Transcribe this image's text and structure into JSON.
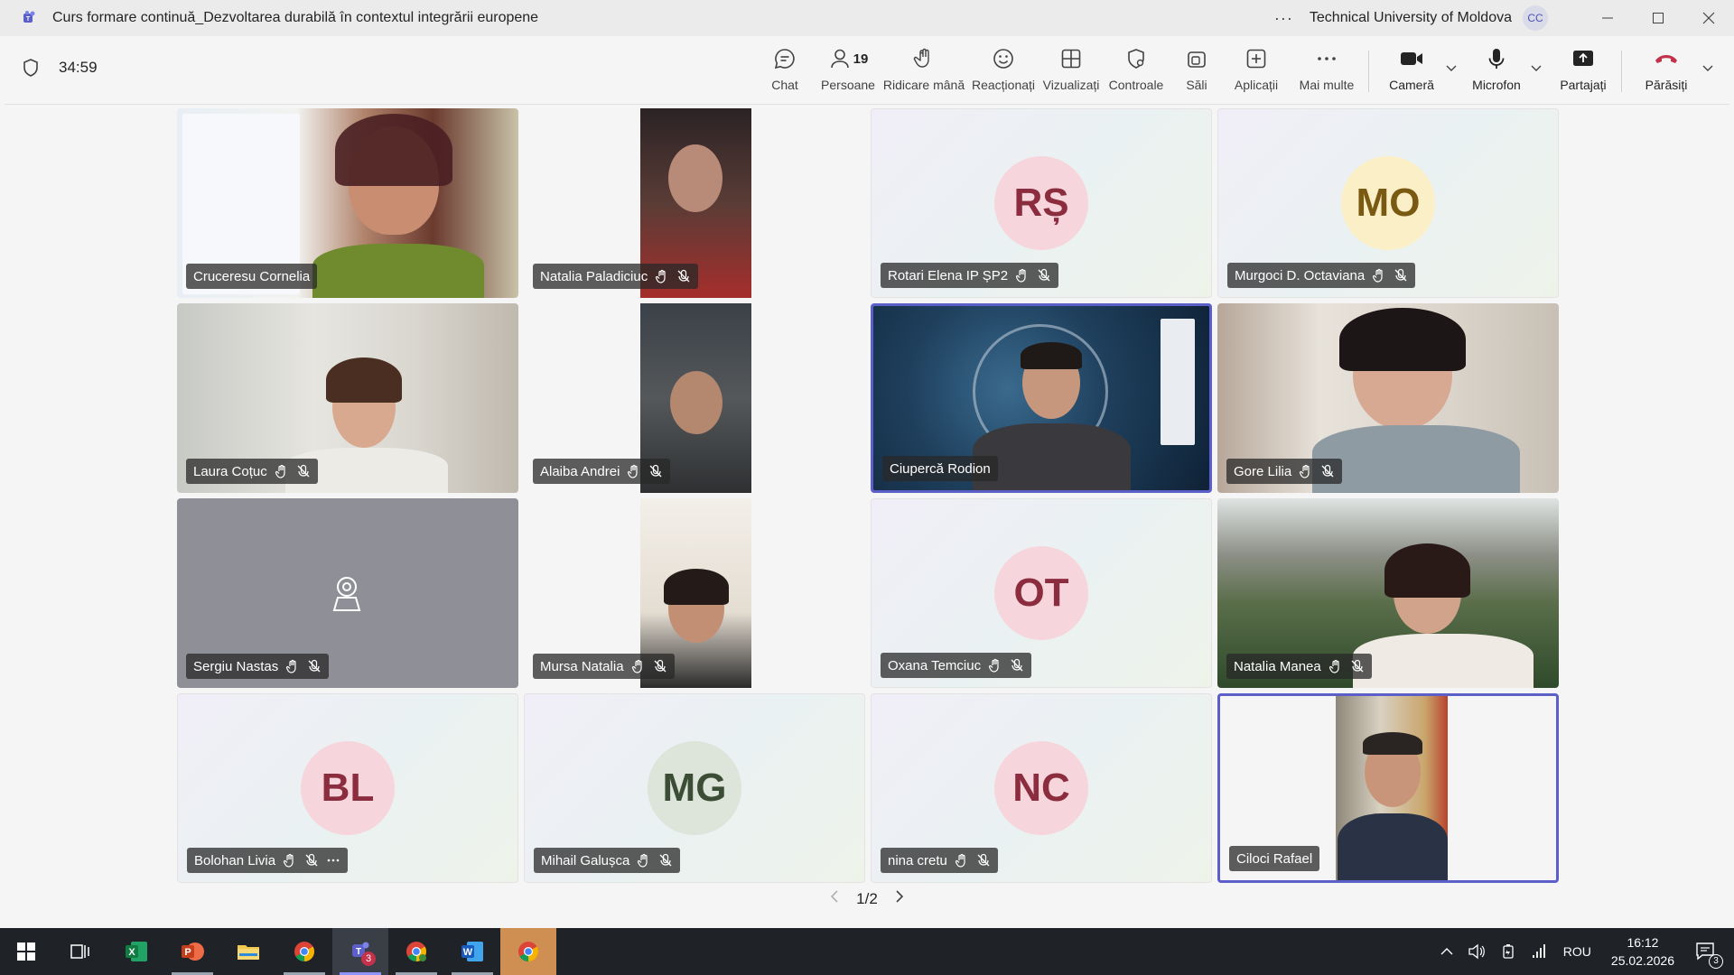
{
  "window": {
    "title": "Curs formare continuă_Dezvoltarea durabilă în contextul integrării europene",
    "more": "···",
    "org": "Technical University of Moldova",
    "avatar_initials": "CC"
  },
  "meeting": {
    "timer": "34:59",
    "toolbar": {
      "chat": "Chat",
      "people": "Persoane",
      "people_count": "19",
      "raise_hand": "Ridicare mână",
      "react": "Reacționați",
      "view": "Vizualizați",
      "controls": "Controale",
      "rooms": "Săli",
      "apps": "Aplicații",
      "more": "Mai multe",
      "camera": "Cameră",
      "mic": "Microfon",
      "share": "Partajați",
      "leave": "Părăsiți"
    }
  },
  "participants": [
    {
      "name": "Cruceresu Cornelia",
      "initials": "",
      "type": "video"
    },
    {
      "name": "Natalia Paladiciuc",
      "initials": "",
      "type": "video"
    },
    {
      "name": "Rotari Elena IP ȘP2",
      "initials": "RȘ",
      "type": "avatar"
    },
    {
      "name": "Murgoci D. Octaviana",
      "initials": "MO",
      "type": "avatar"
    },
    {
      "name": "Laura Coțuc",
      "initials": "",
      "type": "video"
    },
    {
      "name": "Alaiba Andrei",
      "initials": "",
      "type": "video"
    },
    {
      "name": "Ciupercă Rodion",
      "initials": "",
      "type": "video"
    },
    {
      "name": "Gore Lilia",
      "initials": "",
      "type": "video"
    },
    {
      "name": "Sergiu Nastas",
      "initials": "",
      "type": "camera-off"
    },
    {
      "name": "Mursa Natalia",
      "initials": "",
      "type": "video"
    },
    {
      "name": "Oxana Temciuc",
      "initials": "OT",
      "type": "avatar"
    },
    {
      "name": "Natalia Manea",
      "initials": "",
      "type": "video"
    },
    {
      "name": "Bolohan Livia",
      "initials": "BL",
      "type": "avatar"
    },
    {
      "name": "Mihail Galușca",
      "initials": "MG",
      "type": "avatar"
    },
    {
      "name": "nina cretu",
      "initials": "NC",
      "type": "avatar"
    },
    {
      "name": "Ciloci Rafael",
      "initials": "",
      "type": "video"
    }
  ],
  "pager": {
    "label": "1/2"
  },
  "taskbar": {
    "language": "ROU",
    "time": "16:12",
    "date": "25.02.2026",
    "teams_badge": "3",
    "notifications": "3"
  },
  "colors": {
    "accent": "#5b5fc7",
    "leave": "#c4314b",
    "avatar_pink_bg": "#f6d6dc",
    "avatar_pink_fg": "#8c2d3f",
    "avatar_yellow_bg": "#fbefc7",
    "avatar_yellow_fg": "#7a5a12",
    "avatar_green_bg": "#dde4da",
    "avatar_green_fg": "#3c4d35"
  }
}
